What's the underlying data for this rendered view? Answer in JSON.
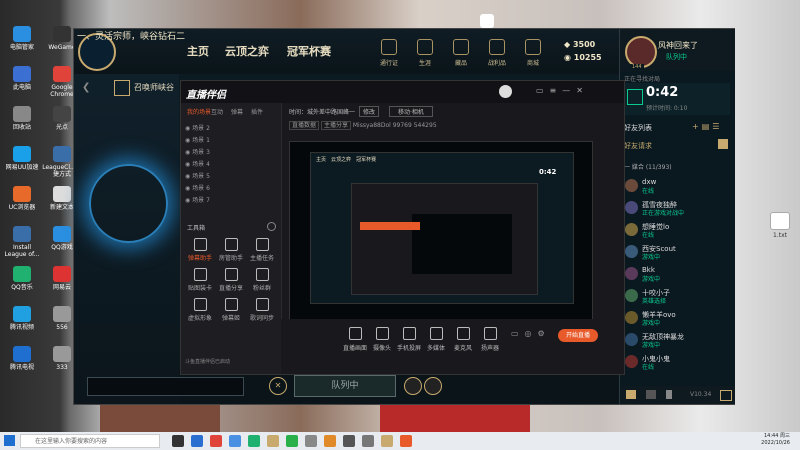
{
  "desktop": {
    "icons": [
      {
        "label": "电脑管家",
        "color": "#2a8fe0"
      },
      {
        "label": "WeGame",
        "color": "#333"
      },
      {
        "label": "此电脑",
        "color": "#3b6fd1"
      },
      {
        "label": "Google Chrome",
        "color": "#e0433a"
      },
      {
        "label": "回收站",
        "color": "#888"
      },
      {
        "label": "光点",
        "color": "#444"
      },
      {
        "label": "网易UU加速",
        "color": "#1aa0e8"
      },
      {
        "label": "LeagueCl...快捷方式",
        "color": "#3a6ea8"
      },
      {
        "label": "UC浏览器",
        "color": "#e86a2a"
      },
      {
        "label": "新建文本",
        "color": "#ddd"
      },
      {
        "label": "Install League of...",
        "color": "#3a6ea8"
      },
      {
        "label": "QQ游戏",
        "color": "#2a8fe0"
      },
      {
        "label": "QQ音乐",
        "color": "#20b070"
      },
      {
        "label": "网易云",
        "color": "#d33"
      },
      {
        "label": "腾讯视频",
        "color": "#20a0e0"
      },
      {
        "label": "556",
        "color": "#999"
      },
      {
        "label": "腾讯电视",
        "color": "#1e6fd0"
      },
      {
        "label": "333",
        "color": "#999"
      }
    ],
    "file_label": "1.txt"
  },
  "lol": {
    "banner": "一、灵活宗师，峡谷钻石二",
    "tabs": [
      "主页",
      "云顶之弈",
      "冠军杯赛"
    ],
    "nav_icons": [
      {
        "name": "pass",
        "label": "通行证"
      },
      {
        "name": "collection",
        "label": "生涯"
      },
      {
        "name": "loot",
        "label": "藏品"
      },
      {
        "name": "tft",
        "label": "战利品"
      },
      {
        "name": "store",
        "label": "商城"
      }
    ],
    "currency_be": "3500",
    "currency_rp": "10255",
    "left_title": "召唤师峡谷",
    "bottom_button": "队列中"
  },
  "friends": {
    "username": "风神回来了",
    "status": "队列中",
    "level": "144",
    "queue_label": "正在寻找对局",
    "timer": "0:42",
    "est_label": "预计时间: 0:10",
    "list_title": "好友列表",
    "requests": "好友请求",
    "group": "一 媒合 (11/393)",
    "items": [
      {
        "name": "dxw",
        "status": "在线",
        "color": "#6a4a3a"
      },
      {
        "name": "孤雪夜独醉",
        "status": "正在游戏对战中",
        "color": "#4a4a7a"
      },
      {
        "name": "想睡觉lo",
        "status": "在线",
        "color": "#7a6a3a"
      },
      {
        "name": "西安Scout",
        "status": "游戏中",
        "color": "#3a5a7a"
      },
      {
        "name": "Bkk",
        "status": "游戏中",
        "color": "#5a3a5a"
      },
      {
        "name": "十咬小子",
        "status": "英雄选择",
        "color": "#3a6a4a"
      },
      {
        "name": "懒羊羊ovo",
        "status": "游戏中",
        "color": "#6a5a2a"
      },
      {
        "name": "无敌顶神暴龙",
        "status": "游戏中",
        "color": "#2a4a6a"
      },
      {
        "name": "小鬼小鬼",
        "status": "在线",
        "color": "#6a2a2a"
      }
    ],
    "version": "V10.34"
  },
  "zb": {
    "title": "直播伴侣",
    "left_tabs": [
      "我的场景",
      "互动",
      "弹幕",
      "插件"
    ],
    "scenes": [
      "场景 2",
      "场景 1",
      "场景 3",
      "场景 4",
      "场景 5",
      "场景 6",
      "场景 7"
    ],
    "tools_label": "工具箱",
    "tools": [
      "弹幕助手",
      "房管助手",
      "主播任务",
      "贴图装卡",
      "直播分享",
      "粉丝群",
      "虚拟形象",
      "弹幕姬",
      "歌词同步"
    ],
    "top_info": "时间：城外差中路国峰一",
    "top_btn": "修改",
    "top_btn2": "移动·相机",
    "stats": [
      "直播数据",
      "主播分享",
      "Missya88Dol",
      "99769",
      "544295"
    ],
    "bottom": [
      {
        "name": "screen-capture",
        "label": "直播画面"
      },
      {
        "name": "camera",
        "label": "摄像头"
      },
      {
        "name": "phone",
        "label": "手机投屏"
      },
      {
        "name": "media",
        "label": "多媒体"
      },
      {
        "name": "mic",
        "label": "麦克风"
      },
      {
        "name": "speaker",
        "label": "扬声器"
      }
    ],
    "live_button": "开始直播",
    "status_text": "斗鱼直播伴侣已启动"
  },
  "taskbar": {
    "search_placeholder": "在这里输入你要搜索的内容",
    "time": "14:44 周三",
    "date": "2022/10/26"
  }
}
